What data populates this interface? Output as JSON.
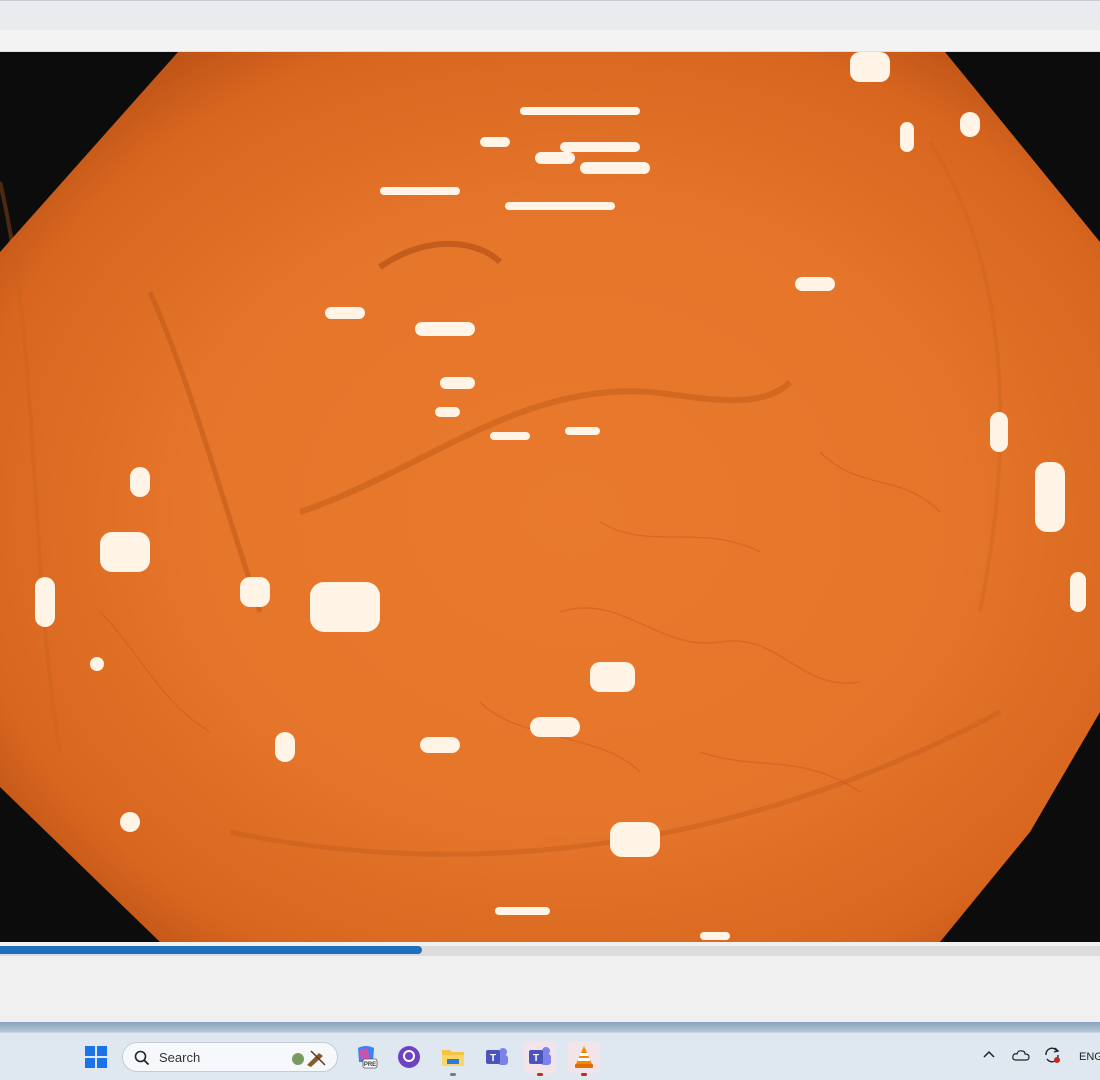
{
  "player": {
    "progress_fraction": 0.384
  },
  "taskbar": {
    "search_label": "Search",
    "language": "ENG",
    "apps": [
      {
        "name": "start-menu-icon"
      },
      {
        "name": "copilot-pre-icon"
      },
      {
        "name": "github-icon"
      },
      {
        "name": "file-explorer-icon"
      },
      {
        "name": "teams-classic-icon"
      },
      {
        "name": "teams-icon"
      },
      {
        "name": "vlc-icon"
      }
    ],
    "tray": [
      "chevron-up-icon",
      "onedrive-cloud-icon",
      "sync-icon"
    ]
  },
  "colors": {
    "progress": "#1f6fbf",
    "mucosa": "#e5772b",
    "taskbar": "#dfe7f0"
  }
}
